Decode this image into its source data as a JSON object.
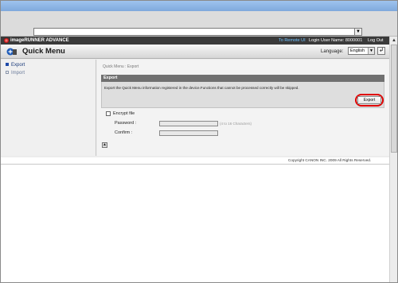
{
  "browser": {
    "address_value": "",
    "dropdown_glyph": "▼",
    "scroll_up_glyph": "▲"
  },
  "header": {
    "product": "imageRUNNER ADVANCE",
    "remote_ui_link": "To Remote UI",
    "login_user": "Login User Name: 8000001",
    "logout": "Log Out"
  },
  "title_row": {
    "title": "Quick Menu",
    "language_label": "Language:",
    "language_value": "English",
    "language_arrow": "▼",
    "go_glyph": "↲"
  },
  "sidebar": {
    "items": [
      {
        "label": "Export",
        "selected": true
      },
      {
        "label": "Import",
        "selected": false
      }
    ]
  },
  "main": {
    "breadcrumb": "Quick Menu : Export",
    "section_title": "Export",
    "description": "Export the Quick Menu information registered in the device.Functions that cannot be processed correctly will be skipped.",
    "export_button": "Export",
    "encrypt_label": "Encrypt file",
    "encrypt_checked": false,
    "password_label": "Password :",
    "password_hint": "(4 to 16 Characters)",
    "confirm_label": "Confirm :",
    "to_top_glyph": "▲"
  },
  "footer": {
    "copyright": "Copyright CANON INC. 2009 All Rights Reserved."
  },
  "colors": {
    "header_bg": "#3a3a3a",
    "remote_link": "#6ec1ff",
    "highlight": "#e00000",
    "section_header": "#707070"
  }
}
